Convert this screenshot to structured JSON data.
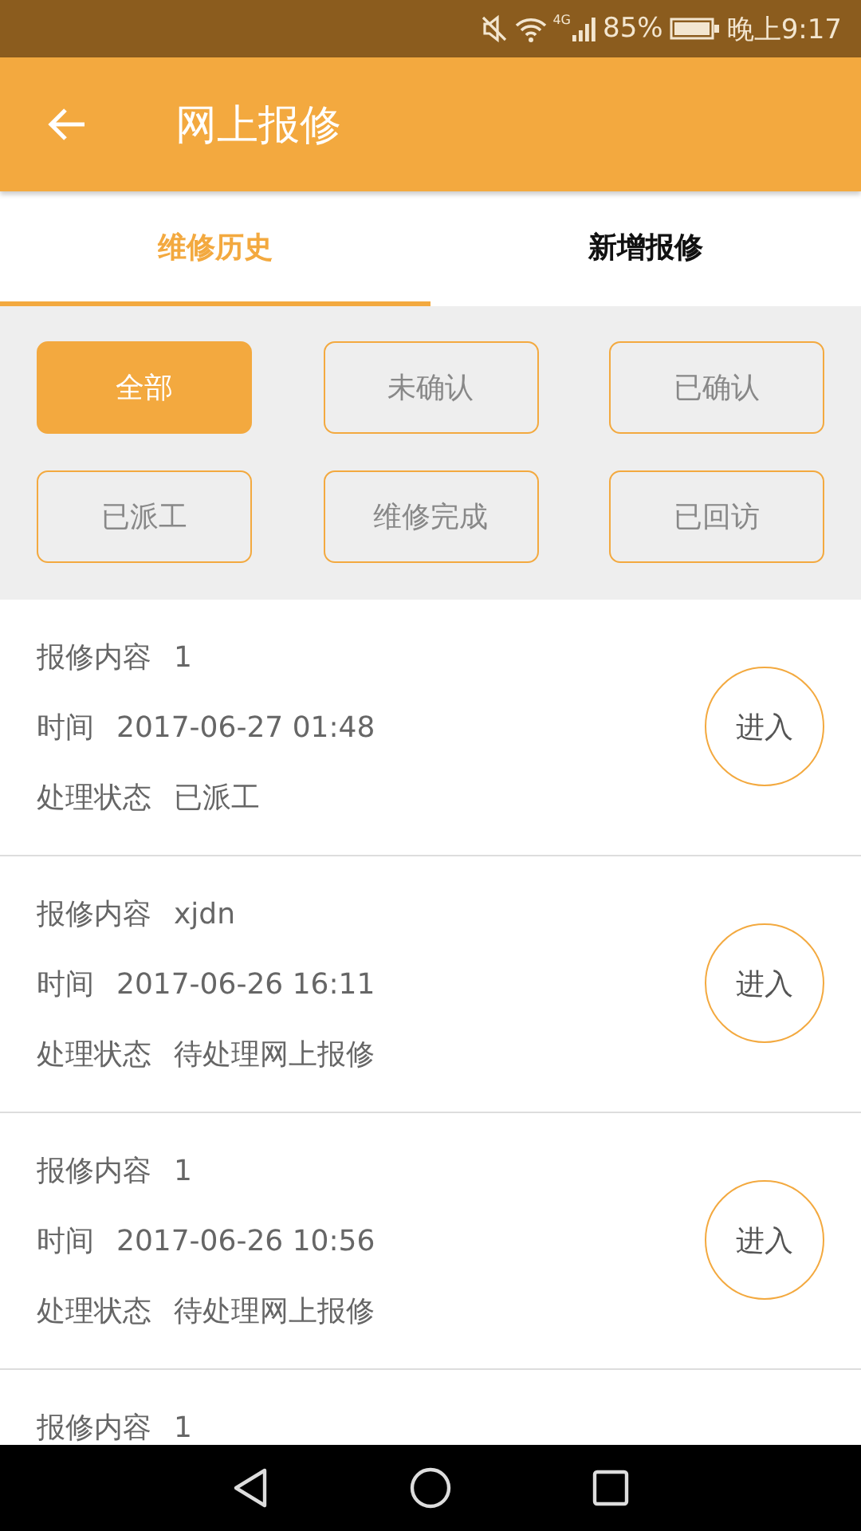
{
  "status_bar": {
    "network": "4G",
    "battery": "85%",
    "time": "晚上9:17"
  },
  "header": {
    "title": "网上报修"
  },
  "tabs": [
    {
      "label": "维修历史",
      "selected": true
    },
    {
      "label": "新增报修",
      "selected": false
    }
  ],
  "filters": [
    {
      "label": "全部",
      "selected": true
    },
    {
      "label": "未确认",
      "selected": false
    },
    {
      "label": "已确认",
      "selected": false
    },
    {
      "label": "已派工",
      "selected": false
    },
    {
      "label": "维修完成",
      "selected": false
    },
    {
      "label": "已回访",
      "selected": false
    }
  ],
  "records": [
    {
      "content_label": "报修内容",
      "content": "1",
      "time_label": "时间",
      "time": "2017-06-27 01:48",
      "status_label": "处理状态",
      "status": "已派工",
      "action": "进入"
    },
    {
      "content_label": "报修内容",
      "content": "xjdn",
      "time_label": "时间",
      "time": "2017-06-26 16:11",
      "status_label": "处理状态",
      "status": "待处理网上报修",
      "action": "进入"
    },
    {
      "content_label": "报修内容",
      "content": "1",
      "time_label": "时间",
      "time": "2017-06-26 10:56",
      "status_label": "处理状态",
      "status": "待处理网上报修",
      "action": "进入"
    },
    {
      "content_label": "报修内容",
      "content": "1"
    }
  ]
}
